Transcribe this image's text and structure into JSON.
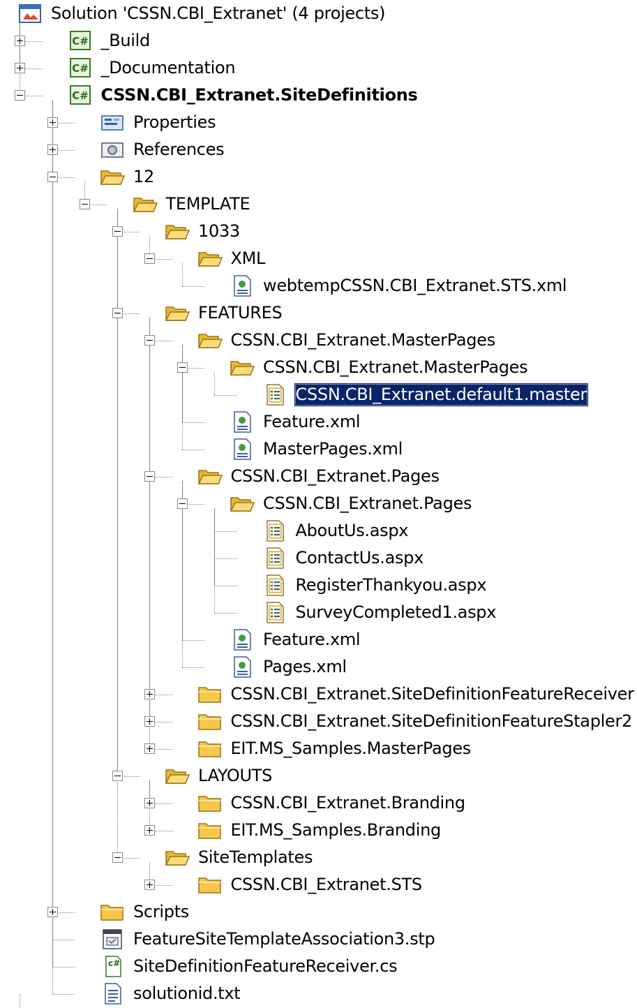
{
  "tree": [
    {
      "label": "Solution 'CSSN.CBI_Extranet' (4 projects)",
      "icon": "solution-icon",
      "state": "root",
      "bold": false,
      "selected": false
    },
    {
      "label": "_Build",
      "icon": "csharp-project-icon",
      "state": "collapsed",
      "bold": false,
      "selected": false
    },
    {
      "label": "_Documentation",
      "icon": "csharp-project-icon",
      "state": "collapsed",
      "bold": false,
      "selected": false
    },
    {
      "label": "CSSN.CBI_Extranet.SiteDefinitions",
      "icon": "csharp-project-icon",
      "state": "expanded",
      "bold": true,
      "selected": false
    },
    {
      "label": "Properties",
      "icon": "properties-icon",
      "state": "collapsed",
      "bold": false,
      "selected": false
    },
    {
      "label": "References",
      "icon": "references-icon",
      "state": "collapsed",
      "bold": false,
      "selected": false
    },
    {
      "label": "12",
      "icon": "folder-open-icon",
      "state": "expanded",
      "bold": false,
      "selected": false
    },
    {
      "label": "TEMPLATE",
      "icon": "folder-open-icon",
      "state": "expanded",
      "bold": false,
      "selected": false
    },
    {
      "label": "1033",
      "icon": "folder-open-icon",
      "state": "expanded",
      "bold": false,
      "selected": false
    },
    {
      "label": "XML",
      "icon": "folder-open-icon",
      "state": "expanded",
      "bold": false,
      "selected": false
    },
    {
      "label": "webtempCSSN.CBI_Extranet.STS.xml",
      "icon": "xml-file-icon",
      "state": "leaf",
      "bold": false,
      "selected": false
    },
    {
      "label": "FEATURES",
      "icon": "folder-open-icon",
      "state": "expanded",
      "bold": false,
      "selected": false
    },
    {
      "label": "CSSN.CBI_Extranet.MasterPages",
      "icon": "folder-open-icon",
      "state": "expanded",
      "bold": false,
      "selected": false
    },
    {
      "label": "CSSN.CBI_Extranet.MasterPages",
      "icon": "folder-open-icon",
      "state": "expanded",
      "bold": false,
      "selected": false
    },
    {
      "label": "CSSN.CBI_Extranet.default1.master",
      "icon": "page-file-icon",
      "state": "leaf",
      "bold": false,
      "selected": true
    },
    {
      "label": "Feature.xml",
      "icon": "xml-file-icon",
      "state": "leaf",
      "bold": false,
      "selected": false
    },
    {
      "label": "MasterPages.xml",
      "icon": "xml-file-icon",
      "state": "leaf",
      "bold": false,
      "selected": false
    },
    {
      "label": "CSSN.CBI_Extranet.Pages",
      "icon": "folder-open-icon",
      "state": "expanded",
      "bold": false,
      "selected": false
    },
    {
      "label": "CSSN.CBI_Extranet.Pages",
      "icon": "folder-open-icon",
      "state": "expanded",
      "bold": false,
      "selected": false
    },
    {
      "label": "AboutUs.aspx",
      "icon": "page-file-icon",
      "state": "leaf",
      "bold": false,
      "selected": false
    },
    {
      "label": "ContactUs.aspx",
      "icon": "page-file-icon",
      "state": "leaf",
      "bold": false,
      "selected": false
    },
    {
      "label": "RegisterThankyou.aspx",
      "icon": "page-file-icon",
      "state": "leaf",
      "bold": false,
      "selected": false
    },
    {
      "label": "SurveyCompleted1.aspx",
      "icon": "page-file-icon",
      "state": "leaf",
      "bold": false,
      "selected": false
    },
    {
      "label": "Feature.xml",
      "icon": "xml-file-icon",
      "state": "leaf",
      "bold": false,
      "selected": false
    },
    {
      "label": "Pages.xml",
      "icon": "xml-file-icon",
      "state": "leaf",
      "bold": false,
      "selected": false
    },
    {
      "label": "CSSN.CBI_Extranet.SiteDefinitionFeatureReceiver",
      "icon": "folder-closed-icon",
      "state": "collapsed",
      "bold": false,
      "selected": false
    },
    {
      "label": "CSSN.CBI_Extranet.SiteDefinitionFeatureStapler2",
      "icon": "folder-closed-icon",
      "state": "collapsed",
      "bold": false,
      "selected": false
    },
    {
      "label": "EIT.MS_Samples.MasterPages",
      "icon": "folder-closed-icon",
      "state": "collapsed",
      "bold": false,
      "selected": false
    },
    {
      "label": "LAYOUTS",
      "icon": "folder-open-icon",
      "state": "expanded",
      "bold": false,
      "selected": false
    },
    {
      "label": "CSSN.CBI_Extranet.Branding",
      "icon": "folder-closed-icon",
      "state": "collapsed",
      "bold": false,
      "selected": false
    },
    {
      "label": "EIT.MS_Samples.Branding",
      "icon": "folder-closed-icon",
      "state": "collapsed",
      "bold": false,
      "selected": false
    },
    {
      "label": "SiteTemplates",
      "icon": "folder-open-icon",
      "state": "expanded",
      "bold": false,
      "selected": false
    },
    {
      "label": "CSSN.CBI_Extranet.STS",
      "icon": "folder-closed-icon",
      "state": "collapsed",
      "bold": false,
      "selected": false
    },
    {
      "label": "Scripts",
      "icon": "folder-closed-icon",
      "state": "collapsed",
      "bold": false,
      "selected": false
    },
    {
      "label": "FeatureSiteTemplateAssociation3.stp",
      "icon": "stp-file-icon",
      "state": "leaf",
      "bold": false,
      "selected": false
    },
    {
      "label": "SiteDefinitionFeatureReceiver.cs",
      "icon": "cs-file-icon",
      "state": "leaf",
      "bold": false,
      "selected": false
    },
    {
      "label": "solutionid.txt",
      "icon": "text-file-icon",
      "state": "leaf",
      "bold": false,
      "selected": false
    }
  ],
  "colors": {
    "selection_bg": "#0a246a",
    "selection_text": "#ffffff",
    "folder": "#f5c84c",
    "connector": "#808080"
  }
}
